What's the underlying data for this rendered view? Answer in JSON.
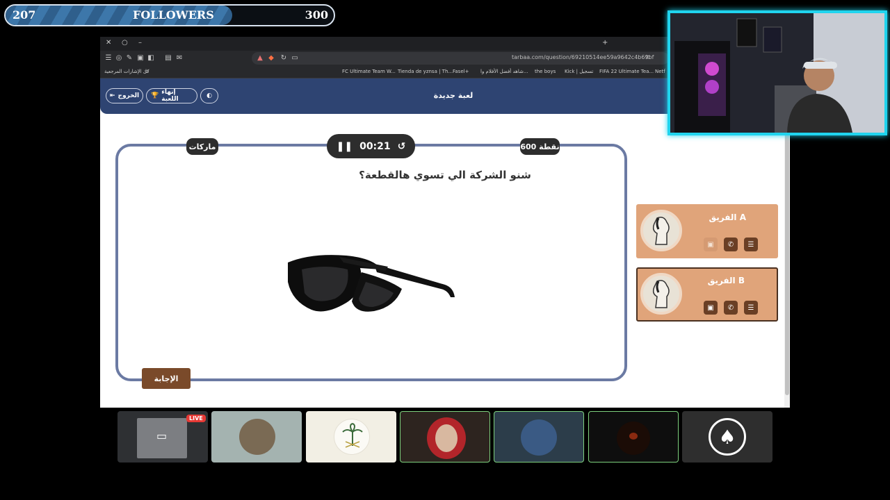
{
  "overlay": {
    "followers_current": "207",
    "followers_label": "FOLLOWERS",
    "followers_goal": "300",
    "followers_progress": 0.69,
    "accent": "#20d4ee",
    "live_label": "LIVE"
  },
  "browser": {
    "url": "tarbaa.com/question/69210514ee59a9642c4b69bf",
    "bookmarks": [
      "FC Ultimate Team W...",
      "Tienda de yznsa | Th...",
      "Fasel+",
      "شاهد أفضل الأفلام وا...",
      "the boys",
      "Kick | تسجيل",
      "FIFA 22 Ultimate Tea...",
      "Netf"
    ],
    "bookmarks_folder": "كل الإشارات المرجعية"
  },
  "app": {
    "title": "لعبة جديدة",
    "exit_label": "الخروج",
    "end_game_label": "إنهاء اللعبة",
    "header_color": "#2e4472"
  },
  "question": {
    "category": "ماركات",
    "points": "600 نقطة",
    "timer": "00:21",
    "text": "شنو الشركة الي تسوي هالقطعة؟",
    "answer_label": "الإجابة"
  },
  "teams": [
    {
      "name": "الفريق A",
      "color": "#e0a47a"
    },
    {
      "name": "الفريق B",
      "color": "#e0a47a"
    }
  ]
}
